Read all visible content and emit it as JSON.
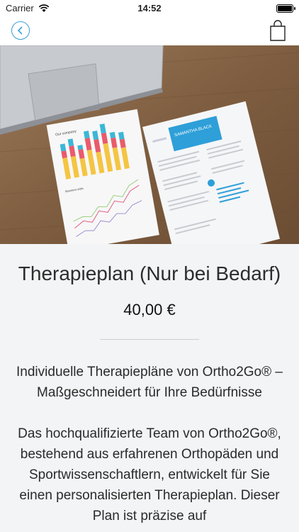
{
  "status_bar": {
    "carrier": "Carrier",
    "time": "14:52"
  },
  "product": {
    "title": "Therapieplan (Nur bei Bedarf)",
    "price": "40,00 €",
    "description_heading": "Individuelle Therapiepläne von Ortho2Go® – Maßgeschneidert für Ihre Bedürfnisse",
    "description_body": "Das hochqualifizierte Team von Ortho2Go®, bestehend aus erfahrenen Orthopäden und Sportwissenschaftlern, entwickelt für Sie einen personalisierten Therapieplan. Dieser Plan ist präzise auf"
  },
  "hero_image": {
    "chart_header": "Our company",
    "chart_subheader": "Business stats",
    "resume_name": "SAMANTHA BLACK"
  },
  "icons": {
    "back": "chevron-left-icon",
    "cart": "shopping-bag-icon",
    "wifi": "wifi-icon",
    "battery": "battery-icon"
  },
  "colors": {
    "accent": "#3a9fd6",
    "background": "#f2f4f5"
  }
}
